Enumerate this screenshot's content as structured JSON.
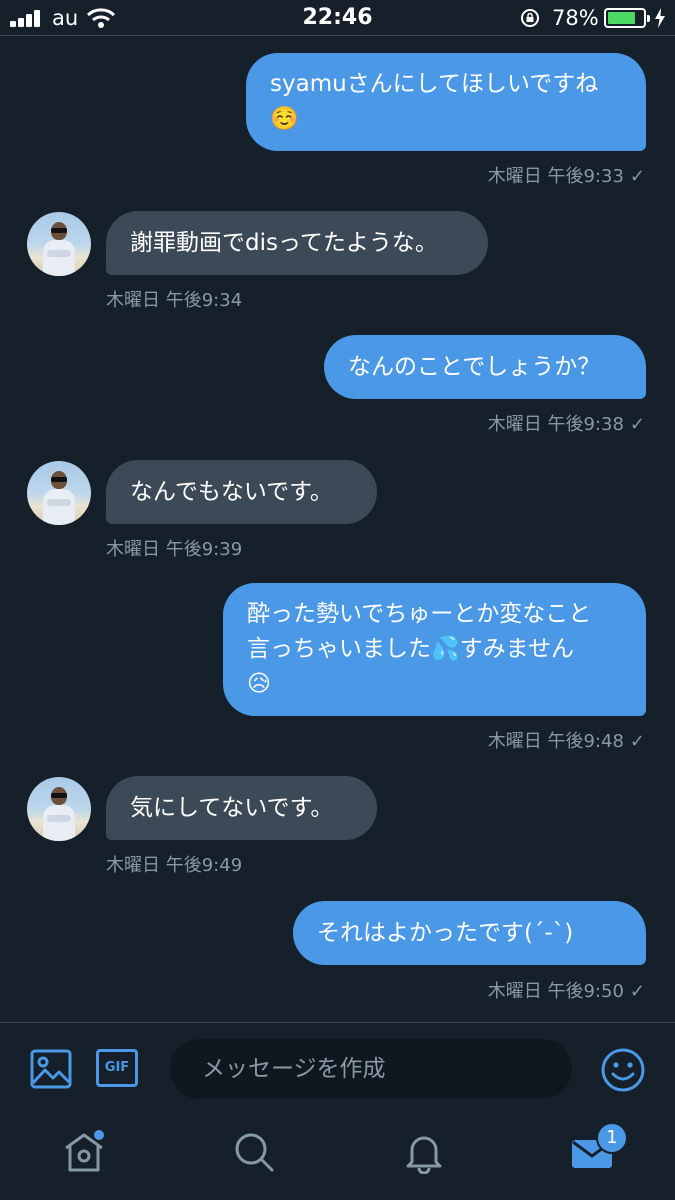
{
  "status_bar": {
    "carrier": "au",
    "time": "22:46",
    "battery_percent": "78%",
    "battery_level": 0.78,
    "icons": [
      "signal-icon",
      "wifi-icon",
      "rotation-lock-icon",
      "battery-icon",
      "charging-icon"
    ]
  },
  "messages": [
    {
      "direction": "sent",
      "text": "syamuさんにしてほしいですね\n☺️",
      "timestamp": "木曜日 午後9:33",
      "read_mark": "✓"
    },
    {
      "direction": "received",
      "text": "謝罪動画でdisってたような。",
      "timestamp": "木曜日 午後9:34"
    },
    {
      "direction": "sent",
      "text": "なんのことでしょうか？",
      "timestamp": "木曜日 午後9:38",
      "read_mark": "✓"
    },
    {
      "direction": "received",
      "text": "なんでもないです。",
      "timestamp": "木曜日 午後9:39"
    },
    {
      "direction": "sent",
      "text": "酔った勢いでちゅーとか変なこと\n言っちゃいました💦すみません\n😥",
      "timestamp": "木曜日 午後9:48",
      "read_mark": "✓"
    },
    {
      "direction": "received",
      "text": "気にしてないです。",
      "timestamp": "木曜日 午後9:49"
    },
    {
      "direction": "sent",
      "text": "それはよかったです(´-`)",
      "timestamp": "木曜日 午後9:50",
      "read_mark": "✓"
    }
  ],
  "composer": {
    "placeholder": "メッセージを作成",
    "gif_label": "GIF",
    "icons": [
      "image-icon",
      "gif-icon",
      "emoji-icon"
    ]
  },
  "tab_bar": {
    "messages_badge": "1",
    "icons": [
      "home-icon",
      "search-icon",
      "notifications-icon",
      "messages-icon"
    ]
  },
  "colors": {
    "background": "#15202b",
    "sent_bubble": "#4a98e6",
    "received_bubble": "#3c4a57",
    "secondary_text": "#8899a6",
    "accent": "#4a98e6"
  }
}
